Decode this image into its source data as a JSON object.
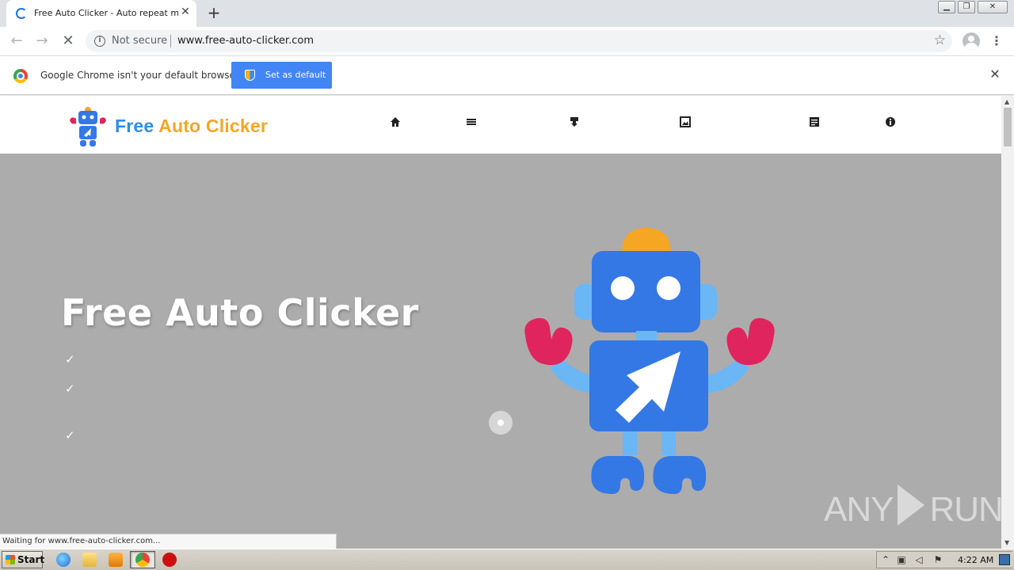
{
  "browser": {
    "tab_title": "Free Auto Clicker - Auto repeat mou",
    "tab_close": "✕",
    "new_tab": "+",
    "security_label": "Not secure",
    "url": "www.free-auto-clicker.com",
    "status_text": "Waiting for www.free-auto-clicker.com..."
  },
  "infobar": {
    "message": "Google Chrome isn't your default browser",
    "button_label": "Set as default",
    "close": "✕"
  },
  "site": {
    "logo_word1": "Free",
    "logo_word2": "Auto Clicker",
    "hero_title": "Free Auto Clicker",
    "nav_icons": [
      "home-icon",
      "menu-icon",
      "download-icon",
      "image-icon",
      "document-icon",
      "info-icon"
    ],
    "check_mark": "✓"
  },
  "watermark": {
    "left": "ANY",
    "right": "RUN"
  },
  "taskbar": {
    "start_label": "Start",
    "clock": "4:22 AM"
  },
  "colors": {
    "hero_bg": "#acacac",
    "accent_blue": "#4285f4",
    "logo_blue": "#2d8cf0",
    "logo_orange": "#f5a623",
    "robot_blue": "#3478e5",
    "robot_pink": "#e0245e"
  }
}
